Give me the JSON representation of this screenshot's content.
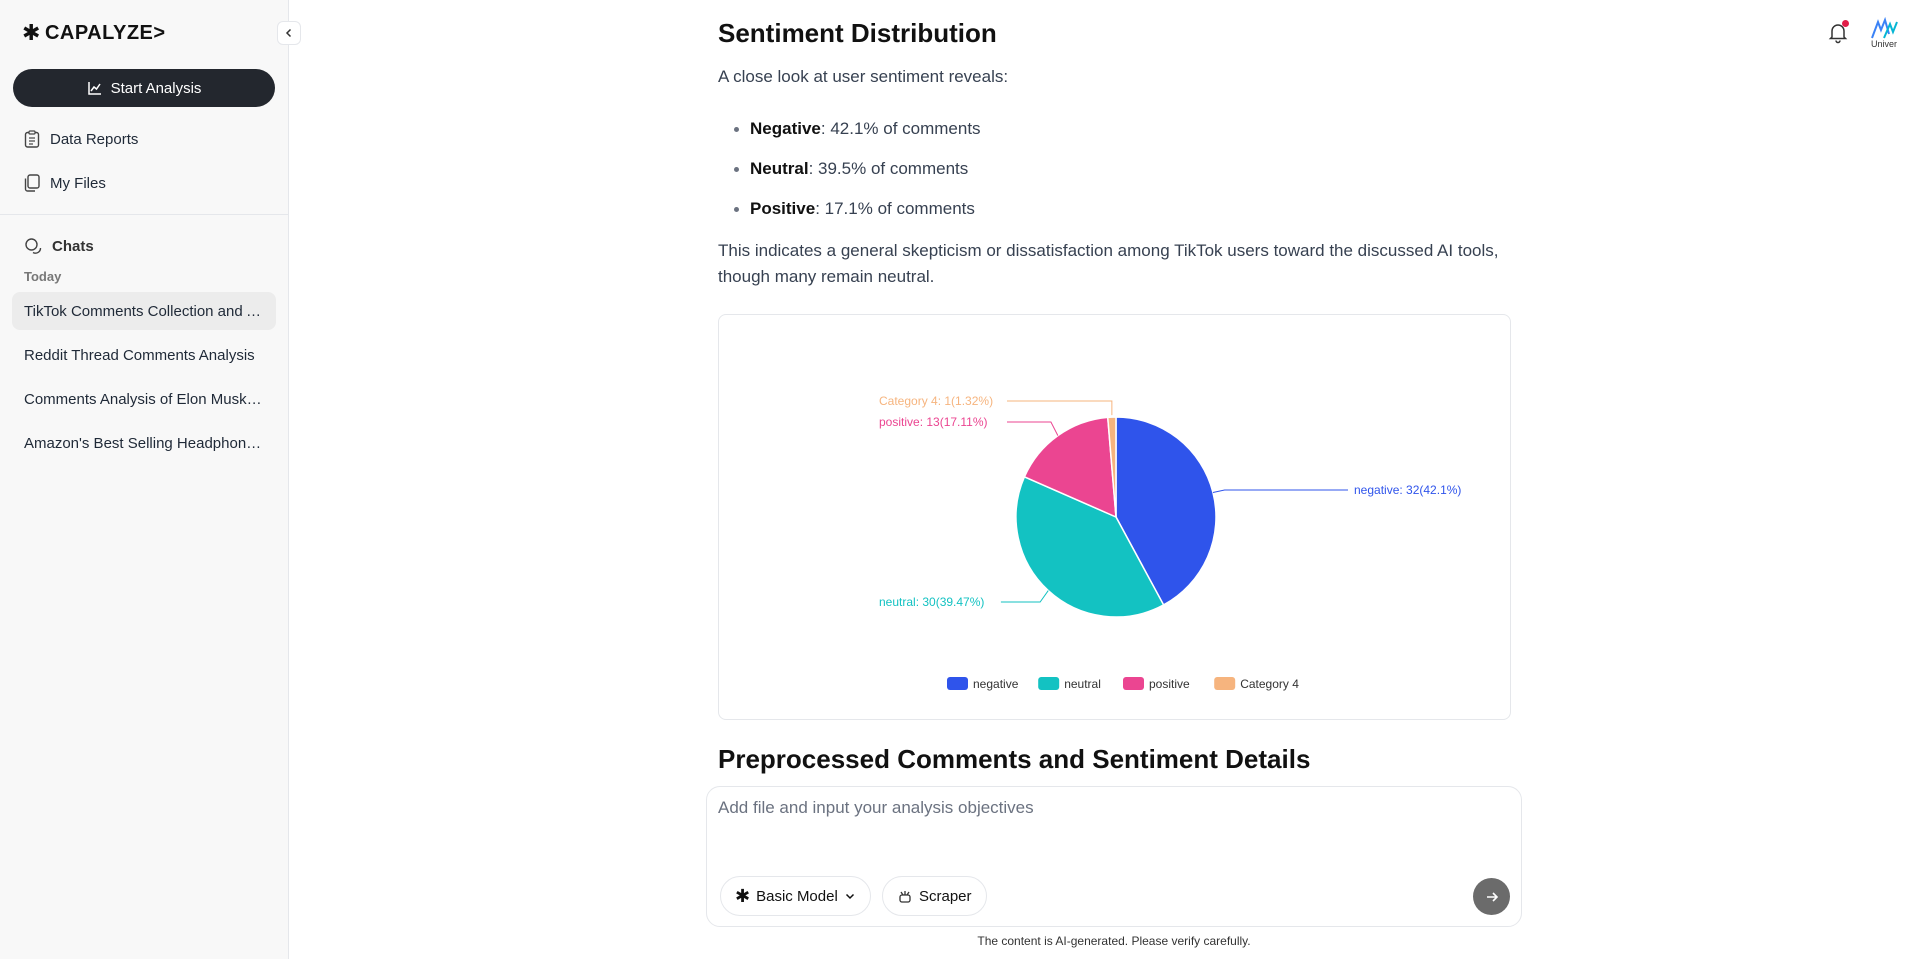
{
  "app": {
    "logo_text": "CAPALYZE>",
    "logo_mark": "✱"
  },
  "sidebar": {
    "start_button": "Start Analysis",
    "nav": [
      {
        "label": "Data Reports",
        "icon": "clipboard-icon"
      },
      {
        "label": "My Files",
        "icon": "files-icon"
      }
    ],
    "chats_label": "Chats",
    "today_label": "Today",
    "chats": [
      {
        "label": "TikTok Comments Collection and Analysis",
        "active": true
      },
      {
        "label": "Reddit Thread Comments Analysis",
        "active": false
      },
      {
        "label": "Comments Analysis of Elon Musk's Post",
        "active": false
      },
      {
        "label": "Amazon's Best Selling Headphones Analysis",
        "active": false
      }
    ]
  },
  "topbar": {
    "avatar_text": "Univer"
  },
  "main": {
    "heading": "Sentiment Distribution",
    "intro": "A close look at user sentiment reveals:",
    "bullets": [
      {
        "label": "Negative",
        "text": ": 42.1% of comments"
      },
      {
        "label": "Neutral",
        "text": ": 39.5% of comments"
      },
      {
        "label": "Positive",
        "text": ": 17.1% of comments"
      }
    ],
    "summary": "This indicates a general skepticism or dissatisfaction among TikTok users toward the discussed AI tools, though many remain neutral.",
    "next_heading": "Preprocessed Comments and Sentiment Details"
  },
  "composer": {
    "placeholder": "Add file and input your analysis objectives",
    "model_label": "Basic Model",
    "scraper_label": "Scraper"
  },
  "footer_note": "The content is AI-generated. Please verify carefully.",
  "chart_data": {
    "type": "pie",
    "slices": [
      {
        "name": "negative",
        "value": 32,
        "percent": "42.1%",
        "color": "#2f54eb",
        "label": "negative: 32(42.1%)"
      },
      {
        "name": "neutral",
        "value": 30,
        "percent": "39.47%",
        "color": "#13c2c2",
        "label": "neutral: 30(39.47%)"
      },
      {
        "name": "positive",
        "value": 13,
        "percent": "17.11%",
        "color": "#eb4591",
        "label": "positive: 13(17.11%)"
      },
      {
        "name": "Category 4",
        "value": 1,
        "percent": "1.32%",
        "color": "#f6b47e",
        "label": "Category 4: 1(1.32%)"
      }
    ],
    "legend": [
      "negative",
      "neutral",
      "positive",
      "Category 4"
    ],
    "legend_position": "bottom"
  }
}
